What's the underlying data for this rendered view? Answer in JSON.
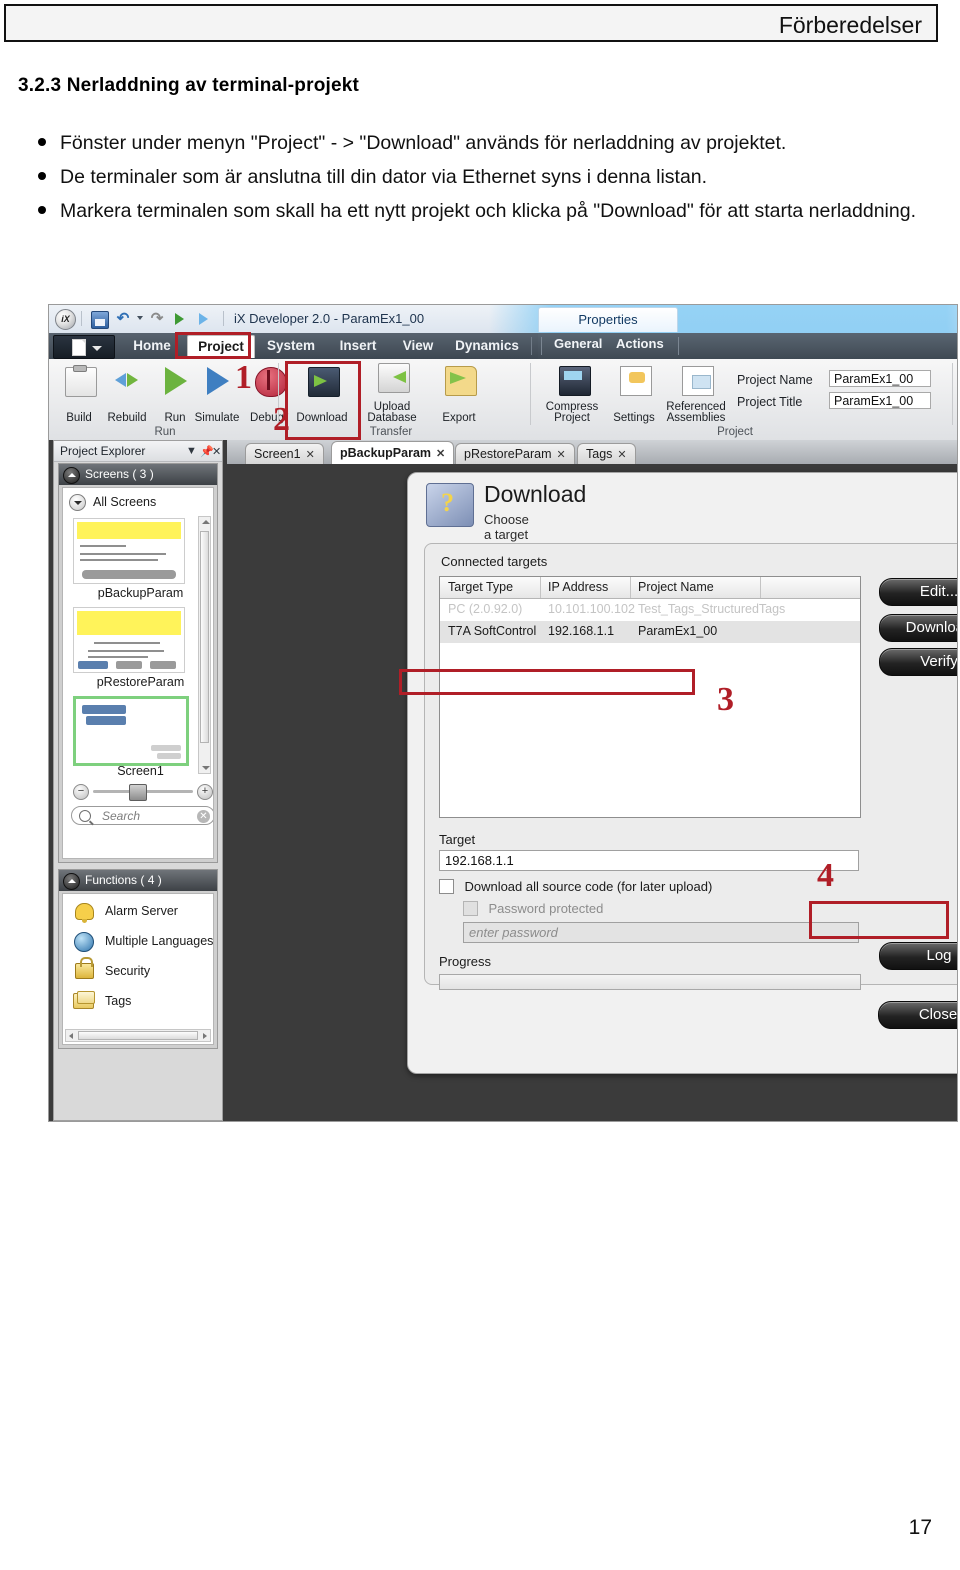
{
  "page": {
    "running_header": "Förberedelser",
    "page_number": "17",
    "section_title": "3.2.3 Nerladdning av terminal-projekt",
    "bullets": [
      "Fönster under menyn \"Project\" - > \"Download\" används för nerladdning av projektet.",
      "De terminaler som är anslutna till din dator via Ethernet syns i denna listan.",
      "Markera terminalen som skall ha ett nytt projekt och klicka på \"Download\" för att starta nerladdning."
    ]
  },
  "annotations": {
    "accent_color": "#b01e27",
    "markers": [
      "1",
      "2",
      "3",
      "4"
    ]
  },
  "app": {
    "titlebar": {
      "orb": "iX",
      "title": "iX Developer 2.0 - ParamEx1_00",
      "quick_access": [
        "save-icon",
        "undo-icon",
        "redo-icon",
        "run-icon",
        "simulate-icon"
      ]
    },
    "contextual_tab": "Properties",
    "sub_tabs": [
      "General",
      "Actions"
    ],
    "ribbon_tabs": [
      {
        "label": "Home",
        "selected": false
      },
      {
        "label": "Project",
        "selected": true
      },
      {
        "label": "System",
        "selected": false
      },
      {
        "label": "Insert",
        "selected": false
      },
      {
        "label": "View",
        "selected": false
      },
      {
        "label": "Dynamics",
        "selected": false
      },
      {
        "label": "G",
        "selected": false
      }
    ],
    "ribbon_groups": [
      {
        "name": "Run",
        "buttons": [
          {
            "label": "Build",
            "icon": "clipboard-icon"
          },
          {
            "label": "Rebuild",
            "icon": "refresh-arrows-icon"
          },
          {
            "label": "Run",
            "icon": "play-green-icon"
          },
          {
            "label": "Simulate",
            "icon": "play-blue-icon"
          },
          {
            "label": "Debug",
            "icon": "bug-icon"
          }
        ]
      },
      {
        "name": "Transfer",
        "buttons": [
          {
            "label": "Download",
            "icon": "download-icon"
          },
          {
            "label": "Upload Database",
            "icon": "upload-database-icon"
          },
          {
            "label": "Export",
            "icon": "export-icon"
          }
        ]
      },
      {
        "name": "Project",
        "buttons": [
          {
            "label": "Compress Project",
            "icon": "compress-icon"
          },
          {
            "label": "Settings",
            "icon": "settings-hand-icon"
          },
          {
            "label": "Referenced Assemblies",
            "icon": "assemblies-icon"
          }
        ],
        "fields": [
          {
            "label": "Project Name",
            "value": "ParamEx1_00"
          },
          {
            "label": "Project Title",
            "value": "ParamEx1_00"
          }
        ]
      }
    ],
    "project_explorer": {
      "title": "Project Explorer",
      "header_icons": [
        "chevron-down-icon",
        "pin-icon",
        "close-icon"
      ],
      "screens_panel": {
        "title": "Screens ( 3 )",
        "all_screens": "All Screens",
        "items": [
          {
            "label": "pBackupParam",
            "selected": false
          },
          {
            "label": "pRestoreParam",
            "selected": false
          },
          {
            "label": "Screen1",
            "selected": true
          }
        ],
        "search_placeholder": "Search"
      },
      "functions_panel": {
        "title": "Functions ( 4 )",
        "items": [
          {
            "label": "Alarm Server",
            "icon": "bell-icon"
          },
          {
            "label": "Multiple Languages",
            "icon": "globe-icon"
          },
          {
            "label": "Security",
            "icon": "lock-icon"
          },
          {
            "label": "Tags",
            "icon": "tags-icon"
          }
        ]
      }
    },
    "editor_tabs": [
      {
        "label": "Screen1",
        "active": false
      },
      {
        "label": "pBackupParam",
        "active": true
      },
      {
        "label": "pRestoreParam",
        "active": false
      },
      {
        "label": "Tags",
        "active": false
      }
    ],
    "download_dialog": {
      "title": "Download",
      "subtitle": "Choose a target to transfer the project to.",
      "connected_targets_label": "Connected targets",
      "columns": [
        "Target Type",
        "IP Address",
        "Project Name"
      ],
      "rows": [
        {
          "target_type": "PC (2.0.92.0)",
          "ip": "10.101.100.102",
          "project": "Test_Tags_StructuredTags",
          "ghost": true,
          "selected": false
        },
        {
          "target_type": "T7A SoftControl",
          "ip": "192.168.1.1",
          "project": "ParamEx1_00",
          "ghost": false,
          "selected": true
        }
      ],
      "edit_button": "Edit...",
      "target_label": "Target",
      "target_value": "192.168.1.1",
      "source_code_checkbox": "Download all source code (for later upload)",
      "password_checkbox": "Password protected",
      "password_placeholder": "enter password",
      "progress_label": "Progress",
      "progress_value": 0,
      "buttons": {
        "download": "Download",
        "verify": "Verify",
        "log": "Log",
        "close": "Close"
      }
    }
  }
}
